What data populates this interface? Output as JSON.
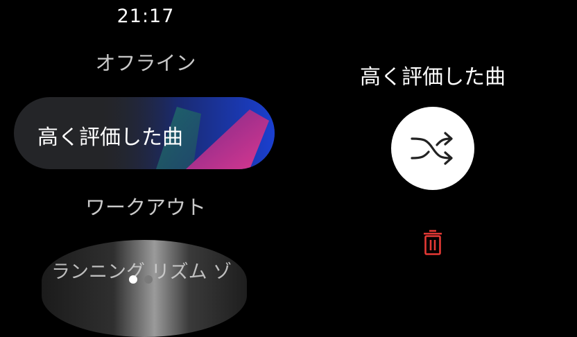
{
  "status_bar": {
    "time": "21:17"
  },
  "playlist_list": {
    "items": [
      {
        "label": "オフライン"
      },
      {
        "label": "高く評価した曲"
      },
      {
        "label": "ワークアウト"
      },
      {
        "label": "ランニング リズム ゾ"
      }
    ],
    "page_count": 2,
    "active_page": 1
  },
  "detail": {
    "title": "高く評価した曲",
    "shuffle_icon": "shuffle-icon",
    "delete_icon": "trash-icon"
  },
  "colors": {
    "background": "#000000",
    "chip_background": "#242528",
    "delete_red": "#e53935",
    "art_blue": "#1a3fd0",
    "art_magenta": "#c2318f",
    "art_teal": "#1f6f6a"
  }
}
